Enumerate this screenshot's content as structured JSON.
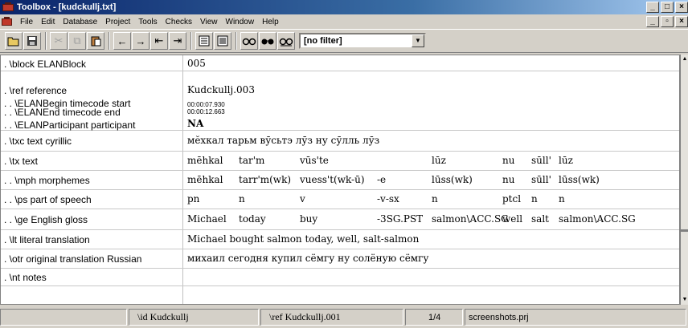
{
  "window": {
    "title": "Toolbox - [kudckullj.txt]",
    "buttons": [
      "_",
      "□",
      "×"
    ],
    "mdi_buttons": [
      "_",
      "▫",
      "×"
    ]
  },
  "menu": [
    "File",
    "Edit",
    "Database",
    "Project",
    "Tools",
    "Checks",
    "View",
    "Window",
    "Help"
  ],
  "toolbar": {
    "filter_value": "[no filter]"
  },
  "record": {
    "rows": [
      {
        "marker": ". \\block  ELANBlock",
        "value": "005"
      },
      {
        "marker": ". \\ref  reference",
        "value": "Kudckullj.003"
      },
      {
        "marker": ". . \\ELANBegin  timecode start",
        "value": "00:00:07.930"
      },
      {
        "marker": ". . \\ELANEnd  timecode end",
        "value": "00:00:12.663"
      },
      {
        "marker": ". . \\ELANParticipant  participant",
        "value": "NA"
      },
      {
        "marker": ". \\txc  text cyrillic",
        "value": "мӗхкал тарьм вӯсьтэ лӯз ну сӯлль лӯз"
      },
      {
        "marker": ". \\tx  text",
        "cells": [
          "mēhkal",
          "tar'm",
          "vūs'te",
          "",
          "lūz",
          "nu",
          "sūll'",
          "lūz"
        ]
      },
      {
        "marker": ". . \\mph  morphemes",
        "cells": [
          "mēhkal",
          "tarr'm(wk)",
          "vuess't(wk-ū)",
          "-e",
          "lūss(wk)",
          "nu",
          "sūll'",
          "lūss(wk)"
        ]
      },
      {
        "marker": ". . \\ps  part of speech",
        "cells": [
          "pn",
          "n",
          "v",
          "-v-sx",
          "n",
          "ptcl",
          "n",
          "n"
        ]
      },
      {
        "marker": ". . \\ge  English gloss",
        "cells": [
          "Michael",
          "today",
          "buy",
          "-3SG.PST",
          "salmon\\ACC.SG",
          "well",
          "salt",
          "salmon\\ACC.SG"
        ]
      },
      {
        "marker": ". \\lt  literal translation",
        "value": "Michael bought salmon today, well, salt-salmon"
      },
      {
        "marker": ". \\otr  original translation Russian",
        "value": "михаил сегодня купил сёмгу ну солёную сёмгу"
      },
      {
        "marker": ". \\nt  notes",
        "value": ""
      }
    ]
  },
  "status": {
    "id": "\\id  Kudckullj",
    "ref": "\\ref  Kudckullj.001",
    "position": "1/4",
    "project": "screenshots.prj"
  }
}
